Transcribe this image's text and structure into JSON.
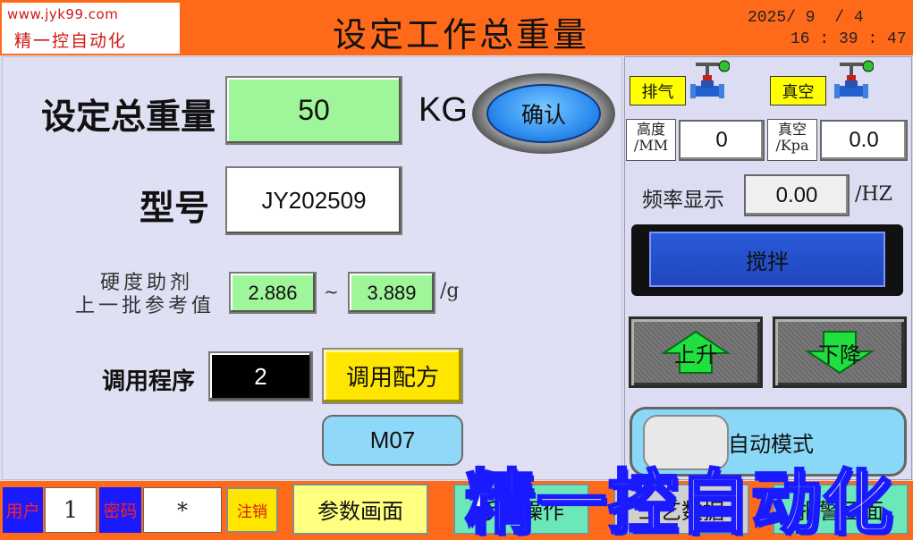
{
  "header": {
    "logo_url": "www.jyk99.com",
    "logo_name": "精一控自动化",
    "title": "设定工作总重量",
    "date": "2025/ 9  / 4",
    "time": "16 : 39 : 47",
    "color": "#ff6a1a"
  },
  "weight": {
    "label": "设定总重量",
    "value": "50",
    "unit": "KG",
    "confirm_label": "确认"
  },
  "model": {
    "label": "型号",
    "value": "JY202509"
  },
  "hardener": {
    "label_line1": "硬度助剂",
    "label_line2": "上一批参考值",
    "min": "2.886",
    "separator": "~",
    "max": "3.889",
    "unit": "/g"
  },
  "program": {
    "label": "调用程序",
    "value": "2",
    "recipe_button": "调用配方",
    "mode_button": "M07"
  },
  "right_panel": {
    "exhaust_tag": "排气",
    "vacuum_tag": "真空",
    "height_label_line1": "高度",
    "height_label_line2": "/MM",
    "height_value": "0",
    "vacuum_label_line1": "真空",
    "vacuum_label_line2": "/Kpa",
    "vacuum_value": "0.0",
    "freq_label": "频率显示",
    "freq_value": "0.00",
    "freq_unit": "/HZ",
    "stir_button": "搅拌",
    "up_button": "上升",
    "down_button": "下降",
    "auto_button": "自动模式"
  },
  "footer": {
    "user_label": "用户",
    "user_value": "1",
    "pwd_label": "密码",
    "pwd_value": "*",
    "logout_button": "注销",
    "nav_params": "参数画面",
    "nav_2": "手动操作",
    "nav_3": "工艺数据",
    "nav_4": "报警画面"
  },
  "watermark": "精一控自动化"
}
